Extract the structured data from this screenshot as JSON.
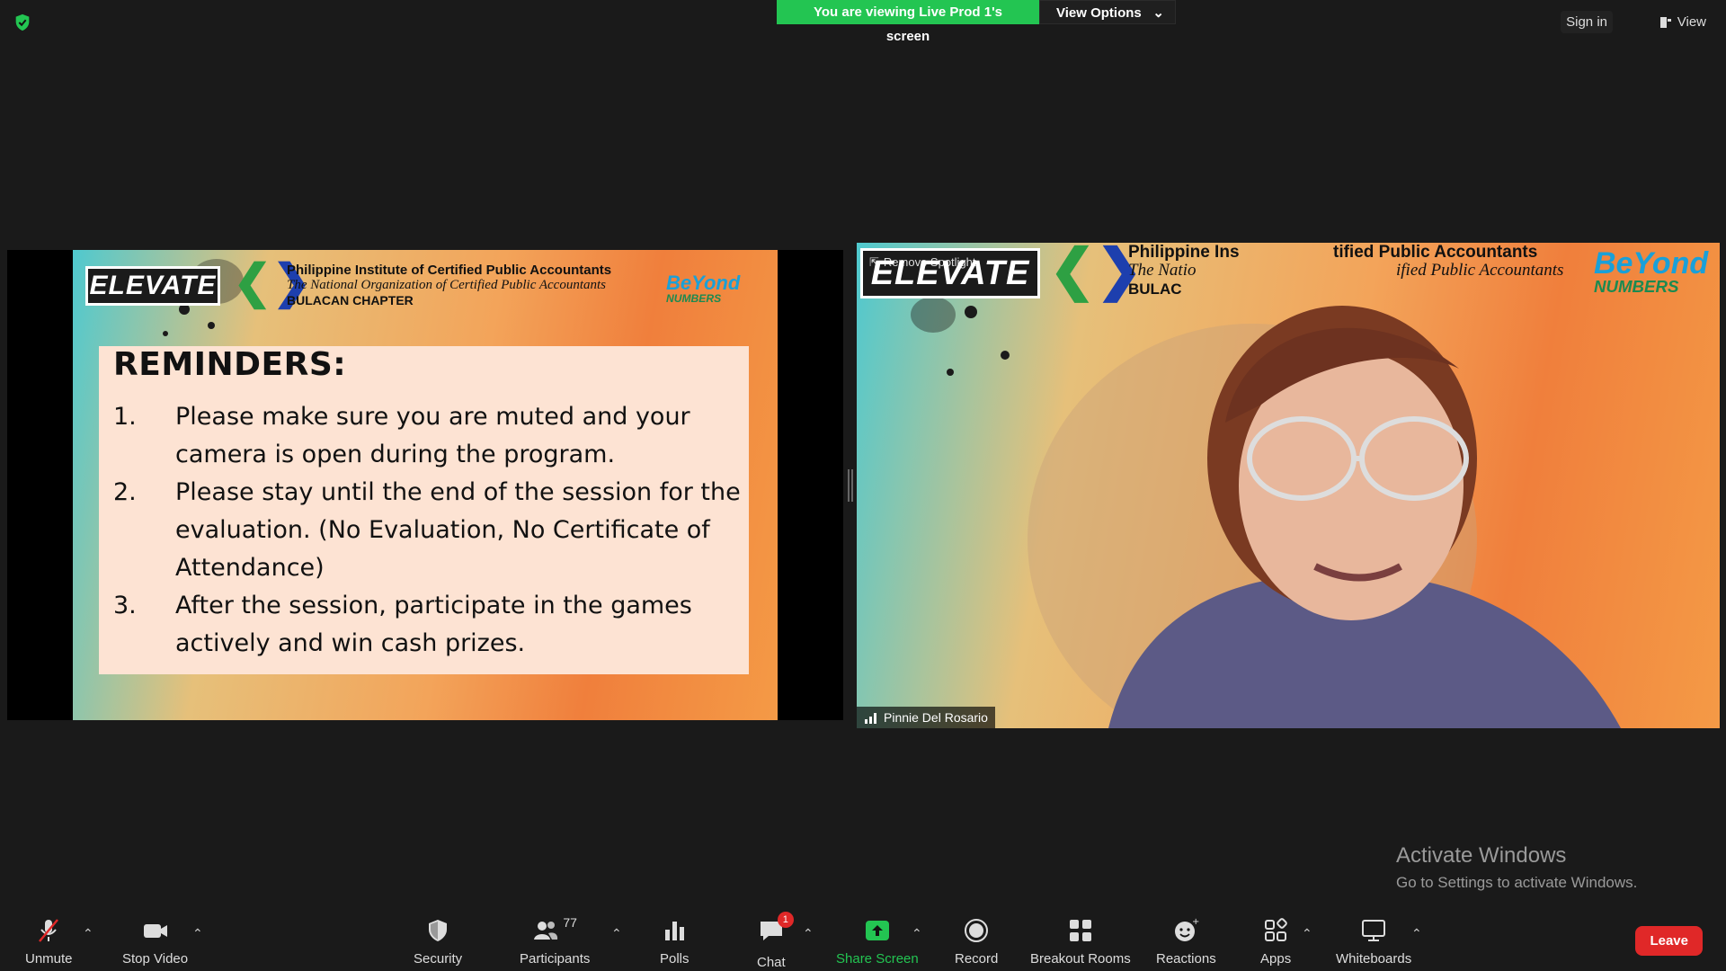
{
  "topbar": {
    "banner": "You are viewing Live Prod 1's screen",
    "view_options": "View Options",
    "sign_in": "Sign in",
    "view": "View"
  },
  "slide": {
    "elevate": "ELEVATE",
    "org_name": "Philippine Institute of Certified Public Accountants",
    "org_tagline": "The National Organization of Certified Public Accountants",
    "org_chapter": "BULACAN CHAPTER",
    "beyond": "BeYond",
    "numbers": "NUMBERS",
    "title": "REMINDERS:",
    "items": [
      {
        "n": "1.",
        "text": "Please make sure you are muted and your camera is open during the program."
      },
      {
        "n": "2.",
        "text": "Please stay until the end of the session for the evaluation. (No Evaluation, No Certificate of Attendance)"
      },
      {
        "n": "3.",
        "text": "After the session, participate in the games actively and win cash prizes."
      }
    ]
  },
  "speaker": {
    "name": "Pinnie Del Rosario",
    "spotlight": "Remove Spotlight",
    "org_line1": "Philippine Ins",
    "org_line1b": "tified Public Accountants",
    "org_line2": "The Natio",
    "org_line2b": "ified Public Accountants",
    "org_line3": "BULAC"
  },
  "watermark": {
    "line1": "Activate Windows",
    "line2": "Go to Settings to activate Windows."
  },
  "toolbar": {
    "unmute": "Unmute",
    "stop_video": "Stop Video",
    "security": "Security",
    "participants": "Participants",
    "participants_count": "77",
    "polls": "Polls",
    "chat": "Chat",
    "chat_badge": "1",
    "share_screen": "Share Screen",
    "record": "Record",
    "breakout": "Breakout Rooms",
    "reactions": "Reactions",
    "apps": "Apps",
    "whiteboards": "Whiteboards",
    "leave": "Leave"
  },
  "colors": {
    "accent_green": "#23c552",
    "leave_red": "#e02828",
    "background": "#1a1a1a"
  }
}
